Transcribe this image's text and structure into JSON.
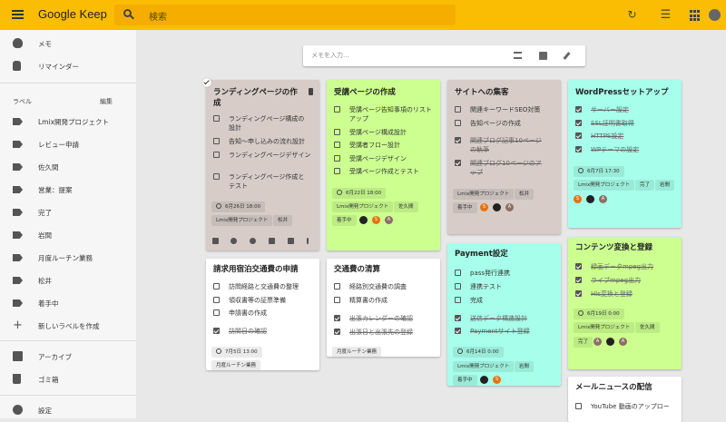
{
  "header": {
    "title": "Google Keep",
    "search_placeholder": "検索"
  },
  "icons": [
    "menu-icon",
    "search-icon",
    "refresh-icon",
    "apps-icon",
    "account-icon"
  ],
  "sidebar": {
    "notes": "メモ",
    "reminders": "リマインダー",
    "label_header": "ラベル",
    "edit": "編集",
    "labels": [
      "Lmix開発プロジェクト",
      "レビュー申請",
      "佐久間",
      "営業：提案",
      "完了",
      "岩間",
      "月度ルーチン業務",
      "松井",
      "着手中"
    ],
    "new_label": "新しいラベルを作成",
    "archive": "アーカイブ",
    "trash": "ゴミ箱",
    "settings": "設定"
  },
  "take_note": {
    "placeholder": "メモを入力..."
  },
  "notes": {
    "landing": {
      "title": [
        "ランディングページの作",
        "成"
      ],
      "items": [
        [
          "ランディングページ構成の",
          "設計"
        ],
        [
          "告知〜申し込みの流れ設計"
        ],
        [
          "ランディングページデザイン"
        ],
        [
          "ランディングページ作成と",
          "テスト"
        ]
      ],
      "reminder": "6月26日 18:00",
      "chips": [
        "Lmix開発プロジェクト",
        "松井"
      ]
    },
    "entry": {
      "title": "受講ページの作成",
      "items": [
        [
          "受講ページ告知事項のリスト",
          "アップ"
        ],
        [
          "受講ページ構成設計"
        ],
        [
          "受講者フロー設計"
        ],
        [
          "受講ページデザイン"
        ],
        [
          "受講ページ作成とテスト"
        ]
      ],
      "reminder": "6月22日 18:00",
      "chips": [
        "Lmix開発プロジェクト",
        "佐久間",
        "着手中"
      ]
    },
    "customers": {
      "title": "サイトへの集客",
      "items": [
        "関連キーワードSEO対策",
        "告知ページの作成"
      ],
      "done": [
        [
          "関連ブログ記事10ページ",
          "の執筆"
        ],
        [
          "関連ブログ10ページのア",
          "ップ"
        ]
      ],
      "chips": [
        "Lmix開発プロジェクト",
        "松井",
        "着手中"
      ]
    },
    "wordpress": {
      "title": "WordPressセットアップ",
      "done": [
        "サーバー設定",
        "SSL証明書取得",
        "HTTPS設定",
        "WPテーマの設定"
      ],
      "reminder": "6月7日 17:30",
      "chips": [
        "Lmix開発プロジェクト",
        "完了",
        "岩間"
      ]
    },
    "lodging": {
      "title": "請求用宿泊交通費の申請",
      "items": [
        "訪問経路と交通費の整理",
        "領収書等の証票準備",
        "申請書の作成"
      ],
      "done": [
        "訪問日の確認"
      ],
      "reminder": "7月5日 13:00",
      "chips": [
        "月度ルーチン業務"
      ]
    },
    "transport": {
      "title": "交通費の清算",
      "items": [
        "経路別交通費の調査",
        "精算書の作成"
      ],
      "done": [
        "出張カレンダーの確認",
        "出張日と出張先の登録"
      ],
      "chips": [
        "月度ルーチン業務"
      ]
    },
    "payment": {
      "title": "Payment設定",
      "items": [
        "pass発行連携",
        "連携テスト",
        "完成"
      ],
      "done": [
        "送信データ構造設計",
        "Paymentサイト登録"
      ],
      "reminder": "6月14日 0:00",
      "chips": [
        "Lmix開発プロジェクト",
        "岩間",
        "着手中"
      ]
    },
    "contents": {
      "title": "コンテンツ変換と登録",
      "done": [
        "録画データmpeg出力",
        "ライブmpeg出力",
        "Hls変換と登録"
      ],
      "reminder": "6月19日 0:00",
      "chips": [
        "Lmix開発プロジェクト",
        "佐久間",
        "完了"
      ]
    },
    "newsletter": {
      "title": "メールニュースの配信",
      "items": [
        "YouTube 動画のアップロー"
      ]
    }
  },
  "avatars": {
    "s": "S",
    "a": "A"
  },
  "colors": {
    "topbar": "#fbbc04",
    "brown": "#d7ccc8",
    "green": "#ccff90",
    "teal": "#a7ffeb",
    "white": "#ffffff"
  }
}
